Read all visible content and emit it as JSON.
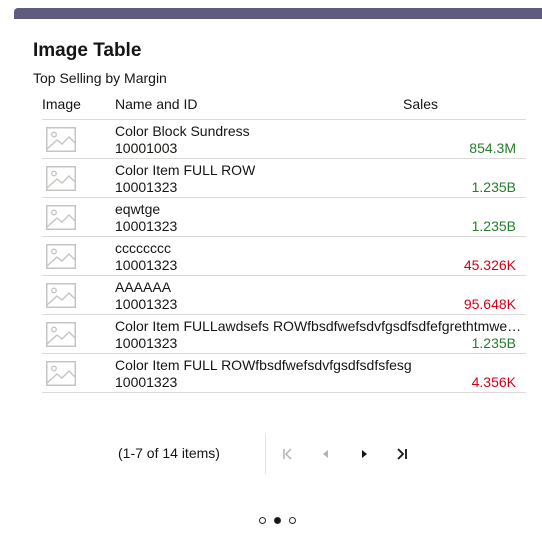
{
  "card": {
    "title": "Image Table",
    "subtitle": "Top Selling by Margin"
  },
  "table": {
    "headers": {
      "image": "Image",
      "name": "Name and ID",
      "sales": "Sales"
    },
    "rows": [
      {
        "name": "Color Block Sundress",
        "id": "10001003",
        "sales": "854.3M",
        "trend": "pos"
      },
      {
        "name": "Color Item FULL ROW",
        "id": "10001323",
        "sales": "1.235B",
        "trend": "pos"
      },
      {
        "name": "eqwtge",
        "id": "10001323",
        "sales": "1.235B",
        "trend": "pos"
      },
      {
        "name": "cccccccc",
        "id": "10001323",
        "sales": "45.326K",
        "trend": "neg"
      },
      {
        "name": "AAAAAA",
        "id": "10001323",
        "sales": "95.648K",
        "trend": "neg"
      },
      {
        "name": "Color Item FULLawdsefs ROWfbsdfwefsdvfgsdfsdfefgrethtmwe…",
        "id": "10001323",
        "sales": "1.235B",
        "trend": "pos"
      },
      {
        "name": "Color Item FULL ROWfbsdfwefsdvfgsdfsdfsfesg",
        "id": "10001323",
        "sales": "4.356K",
        "trend": "neg"
      }
    ]
  },
  "pagination": {
    "status": "(1-7 of 14 items)",
    "first_icon": "first-page-icon",
    "prev_icon": "previous-page-icon",
    "next_icon": "next-page-icon",
    "last_icon": "last-page-icon"
  },
  "carousel": {
    "dots": 3,
    "active": 1
  },
  "colors": {
    "header_bar": "#5e5b7e",
    "positive": "#257d2d",
    "negative": "#d0021b"
  }
}
